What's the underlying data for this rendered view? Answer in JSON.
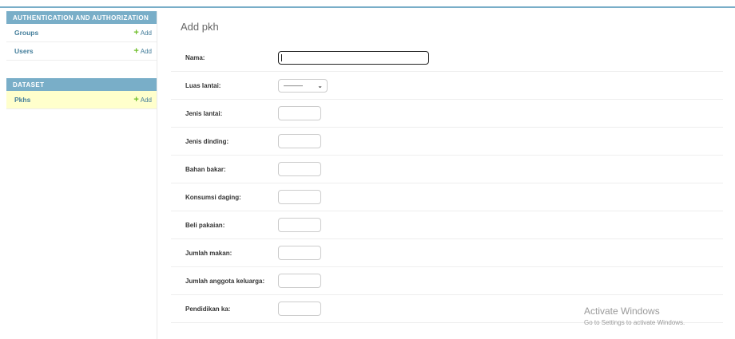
{
  "sidebar": {
    "modules": [
      {
        "caption": "AUTHENTICATION AND AUTHORIZATION",
        "models": [
          {
            "name": "Groups",
            "add": "Add"
          },
          {
            "name": "Users",
            "add": "Add"
          }
        ]
      },
      {
        "caption": "DATASET",
        "models": [
          {
            "name": "Pkhs",
            "add": "Add"
          }
        ]
      }
    ]
  },
  "main": {
    "title": "Add pkh",
    "fields": [
      {
        "label": "Nama:"
      },
      {
        "label": "Luas lantai:",
        "select_value": "———"
      },
      {
        "label": "Jenis lantai:"
      },
      {
        "label": "Jenis dinding:"
      },
      {
        "label": "Bahan bakar:"
      },
      {
        "label": "Konsumsi daging:"
      },
      {
        "label": "Beli pakaian:"
      },
      {
        "label": "Jumlah makan:"
      },
      {
        "label": "Jumlah anggota keluarga:"
      },
      {
        "label": "Pendidikan ka:"
      }
    ]
  },
  "watermark": {
    "title": "Activate Windows",
    "subtitle": "Go to Settings to activate Windows."
  },
  "colors": {
    "header": "#79aec8",
    "link": "#447e9b",
    "add_icon": "#70bf2b",
    "current_row": "#ffffcc"
  }
}
